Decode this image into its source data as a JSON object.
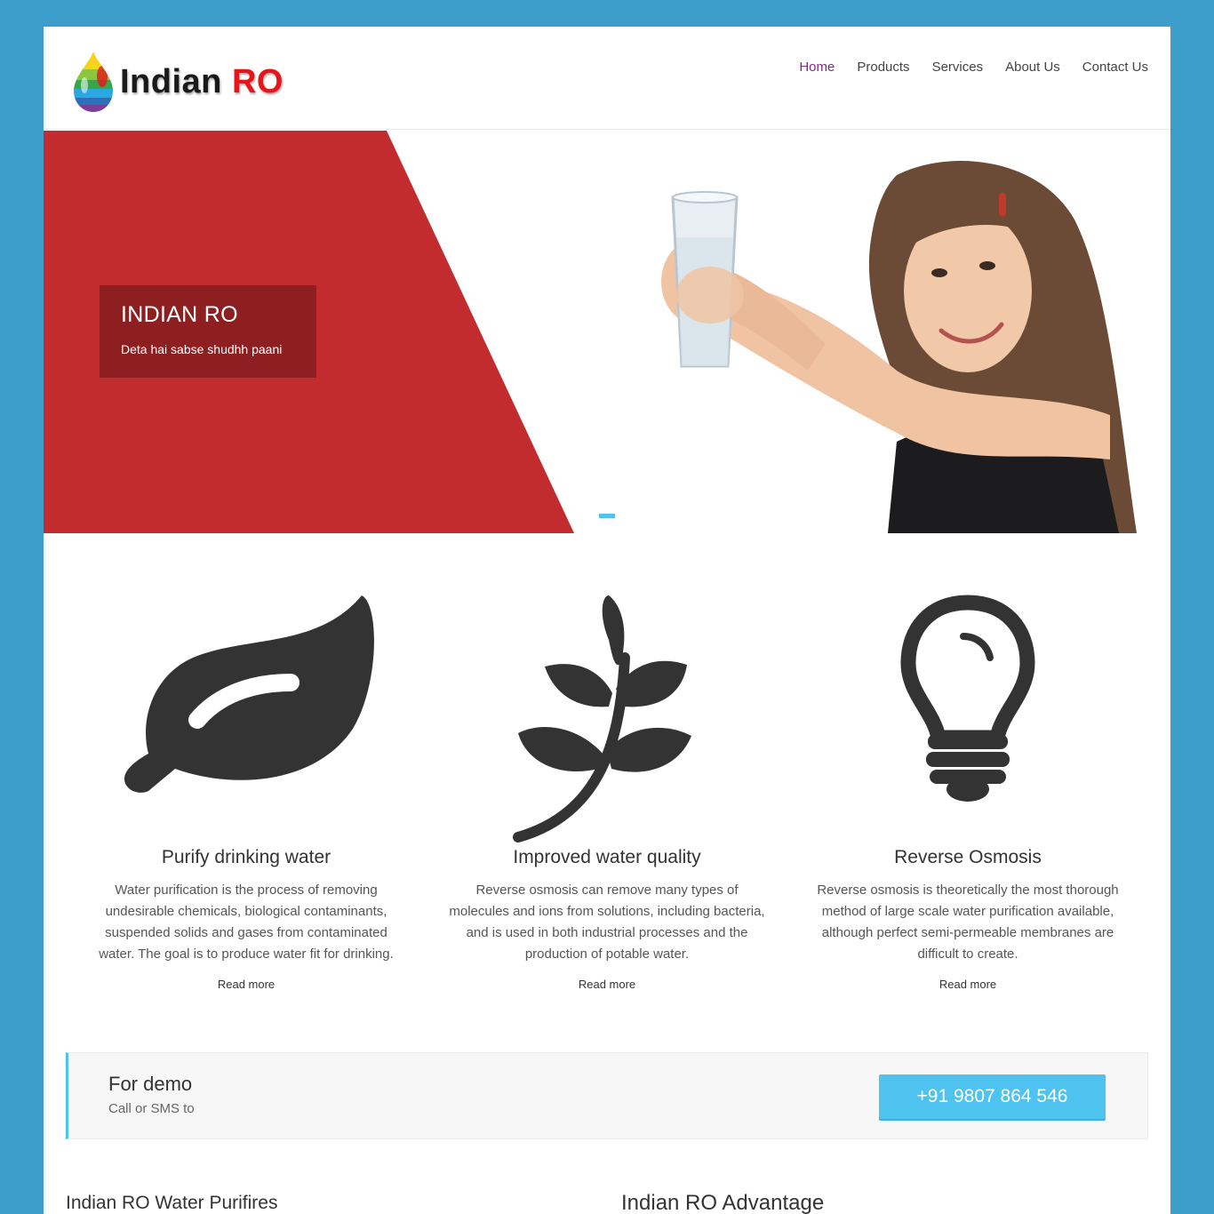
{
  "brand": {
    "word1": "Indian",
    "word2": "RO"
  },
  "nav": {
    "items": [
      {
        "label": "Home",
        "active": true
      },
      {
        "label": "Products",
        "active": false
      },
      {
        "label": "Services",
        "active": false
      },
      {
        "label": "About Us",
        "active": false
      },
      {
        "label": "Contact Us",
        "active": false
      }
    ]
  },
  "hero": {
    "title": "INDIAN RO",
    "subtitle": "Deta hai sabse shudhh paani"
  },
  "features": [
    {
      "icon": "leaf-icon",
      "title": "Purify drinking water",
      "text": "Water purification is the process of removing undesirable chemicals, biological contaminants, suspended solids and gases from contaminated water. The goal is to produce water fit for drinking.",
      "link": "Read more"
    },
    {
      "icon": "plant-sprig-icon",
      "title": "Improved water quality",
      "text": "Reverse osmosis can remove many types of molecules and ions from solutions, including bacteria, and is used in both industrial processes and the production of potable water.",
      "link": "Read more"
    },
    {
      "icon": "light-bulb-icon",
      "title": "Reverse Osmosis",
      "text": "Reverse osmosis is theoretically the most thorough method of large scale water purification available, although perfect semi-permeable membranes are difficult to create.",
      "link": "Read more"
    }
  ],
  "demo": {
    "title": "For demo",
    "subtitle": "Call or SMS to",
    "phone": "+91 9807 864 546"
  },
  "bottom": {
    "left_heading": "Indian RO Water Purifires",
    "right_heading": "Indian RO Advantage"
  },
  "colors": {
    "background": "#3d9ecb",
    "hero_red": "#c22c2f",
    "hero_box": "#8e1f21",
    "accent": "#4fc3ef",
    "nav_active": "#7a2d7d",
    "logo_red": "#e8141b"
  }
}
